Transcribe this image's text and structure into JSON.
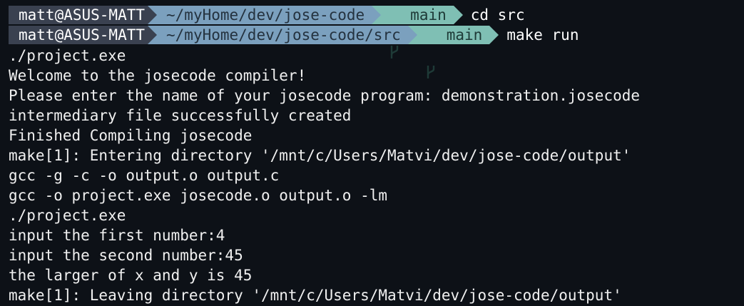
{
  "prompts": [
    {
      "user": "matt@ASUS-MATT",
      "path": "~/myHome/dev/jose-code",
      "branch": "main",
      "command": "cd src"
    },
    {
      "user": "matt@ASUS-MATT",
      "path": "~/myHome/dev/jose-code/src",
      "branch": "main",
      "command": "make run"
    }
  ],
  "output": [
    "./project.exe",
    "Welcome to the josecode compiler!",
    "Please enter the name of your josecode program: demonstration.josecode",
    "intermediary file successfully created",
    "Finished Compiling josecode",
    "make[1]: Entering directory '/mnt/c/Users/Matvi/dev/jose-code/output'",
    "gcc -g -c -o output.o output.c",
    "gcc -o project.exe josecode.o output.o -lm",
    "./project.exe",
    "input the first number:4",
    "input the second number:45",
    "the larger of x and y is 45",
    "make[1]: Leaving directory '/mnt/c/Users/Matvi/dev/jose-code/output'"
  ],
  "colors": {
    "background": "#0d1117",
    "user_segment": "#3a4150",
    "path_segment": "#7ba0be",
    "git_segment": "#7fbfb4",
    "text": "#f0f0f0"
  },
  "icons": {
    "branch": "git-branch-icon"
  }
}
